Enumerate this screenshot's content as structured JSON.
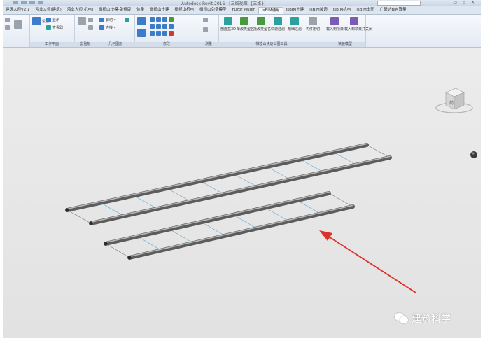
{
  "titlebar": {
    "title": "Autodesk Revit 2016 - [三维视图: {三维}]"
  },
  "ribbon": {
    "tabs": [
      "建筑大师V2.1",
      "鸿业大师(建筑)",
      "鸿业大师(机电)",
      "橄榄山快模-免费版",
      "体量",
      "橄榄山土建",
      "橄榄山机电",
      "橄榄山免费模型",
      "Fuzor Plugin",
      "isBIM通用",
      "isBIM土建",
      "isBIM装饰",
      "isBIM机电",
      "isBIM出图",
      "广联达BIM算量"
    ],
    "active_tab": 9,
    "groups": {
      "work_plane": {
        "label": "工作平面",
        "set": "设置",
        "show": "显示",
        "viewer": "查看器"
      },
      "clipboard": {
        "label": "剪贴板"
      },
      "geometry": {
        "label": "几何图形",
        "cut": "剪切",
        "join": "连接"
      },
      "modify": {
        "label": "修改"
      },
      "measure": {
        "label": "测量"
      },
      "glsquick": {
        "label": "橄榄山快速出图工具",
        "buttons": [
          "剖面盒3D",
          "单改类型名",
          "批改类型名",
          "快速过滤",
          "精细过滤",
          "构件剖切"
        ]
      },
      "project": {
        "label": "快装模型",
        "load_item": "载入到项目",
        "load_close": "载入到项目并关闭"
      }
    }
  },
  "viewcube": {
    "face": "前"
  },
  "watermark": {
    "text": "建筑科学"
  },
  "colors": {
    "rod": "#5c5c5c",
    "rod_highlight": "#b8b8b8",
    "link": "#5aa6d6",
    "arrow": "#e0302a"
  }
}
